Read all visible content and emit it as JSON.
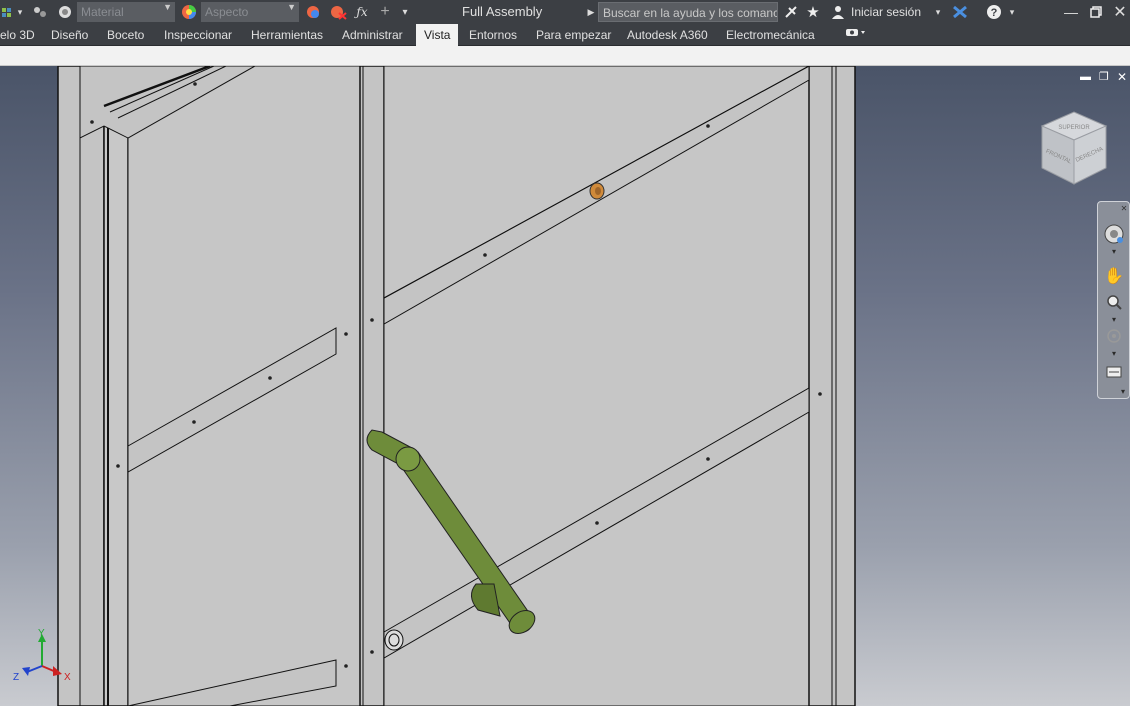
{
  "titlebar": {
    "material_dropdown": "Material",
    "appearance_dropdown": "Aspecto",
    "document_title": "Full Assembly",
    "search_placeholder": "Buscar en la ayuda y los comanc",
    "signin_label": "Iniciar sesión"
  },
  "tabs": [
    {
      "label": "elo 3D"
    },
    {
      "label": "Diseño"
    },
    {
      "label": "Boceto"
    },
    {
      "label": "Inspeccionar"
    },
    {
      "label": "Herramientas"
    },
    {
      "label": "Administrar"
    },
    {
      "label": "Vista",
      "active": true
    },
    {
      "label": "Entornos"
    },
    {
      "label": "Para empezar"
    },
    {
      "label": "Autodesk A360"
    },
    {
      "label": "Electromecánica"
    }
  ],
  "viewcube": {
    "faces": [
      "SUPERIOR",
      "FRONTAL",
      "DERECHA"
    ]
  },
  "triad": {
    "x": "X",
    "y": "Y",
    "z": "Z"
  },
  "colors": {
    "handle": "#6e8c3a",
    "sheet": "#c4c4c4",
    "accent_knob": "#d08a3a",
    "axis_x": "#cc2222",
    "axis_y": "#22aa33",
    "axis_z": "#2244cc"
  }
}
